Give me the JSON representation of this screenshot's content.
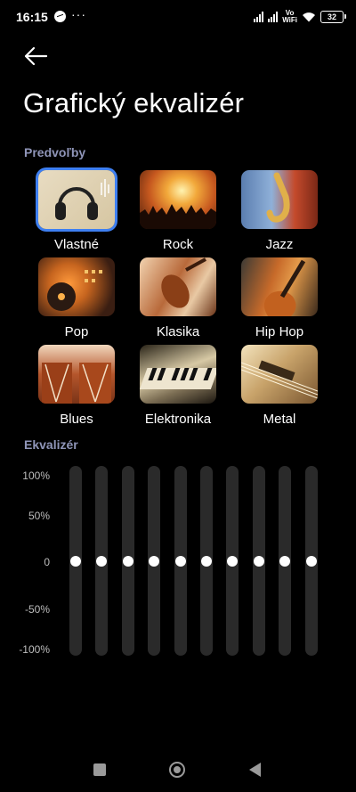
{
  "status_bar": {
    "time": "16:15",
    "icons": [
      "messenger-icon",
      "more-dots-icon",
      "signal-icon",
      "signal-icon",
      "vowifi-icon",
      "wifi-icon",
      "battery-icon"
    ],
    "dots": "···",
    "vowifi": "Vo\nWiFi",
    "battery": "32"
  },
  "header": {
    "back_icon": "arrow-left-icon",
    "title": "Grafický ekvalizér"
  },
  "presets": {
    "label": "Predvoľby",
    "selected": "Vlastné",
    "items": [
      {
        "label": "Vlastné"
      },
      {
        "label": "Rock"
      },
      {
        "label": "Jazz"
      },
      {
        "label": "Pop"
      },
      {
        "label": "Klasika"
      },
      {
        "label": "Hip Hop"
      },
      {
        "label": "Blues"
      },
      {
        "label": "Elektronika"
      },
      {
        "label": "Metal"
      }
    ]
  },
  "equalizer": {
    "label": "Ekvalizér",
    "axis": [
      "100%",
      "50%",
      "0",
      "-50%",
      "-100%"
    ],
    "bands": [
      0,
      0,
      0,
      0,
      0,
      0,
      0,
      0,
      0,
      0
    ]
  },
  "nav": {
    "icons": [
      "recents-square-icon",
      "home-circle-icon",
      "back-triangle-icon"
    ]
  },
  "colors": {
    "background": "#000000",
    "accent": "#3e7ff1",
    "section_label": "#8f95b8",
    "slider_track": "#2a2a2a"
  }
}
